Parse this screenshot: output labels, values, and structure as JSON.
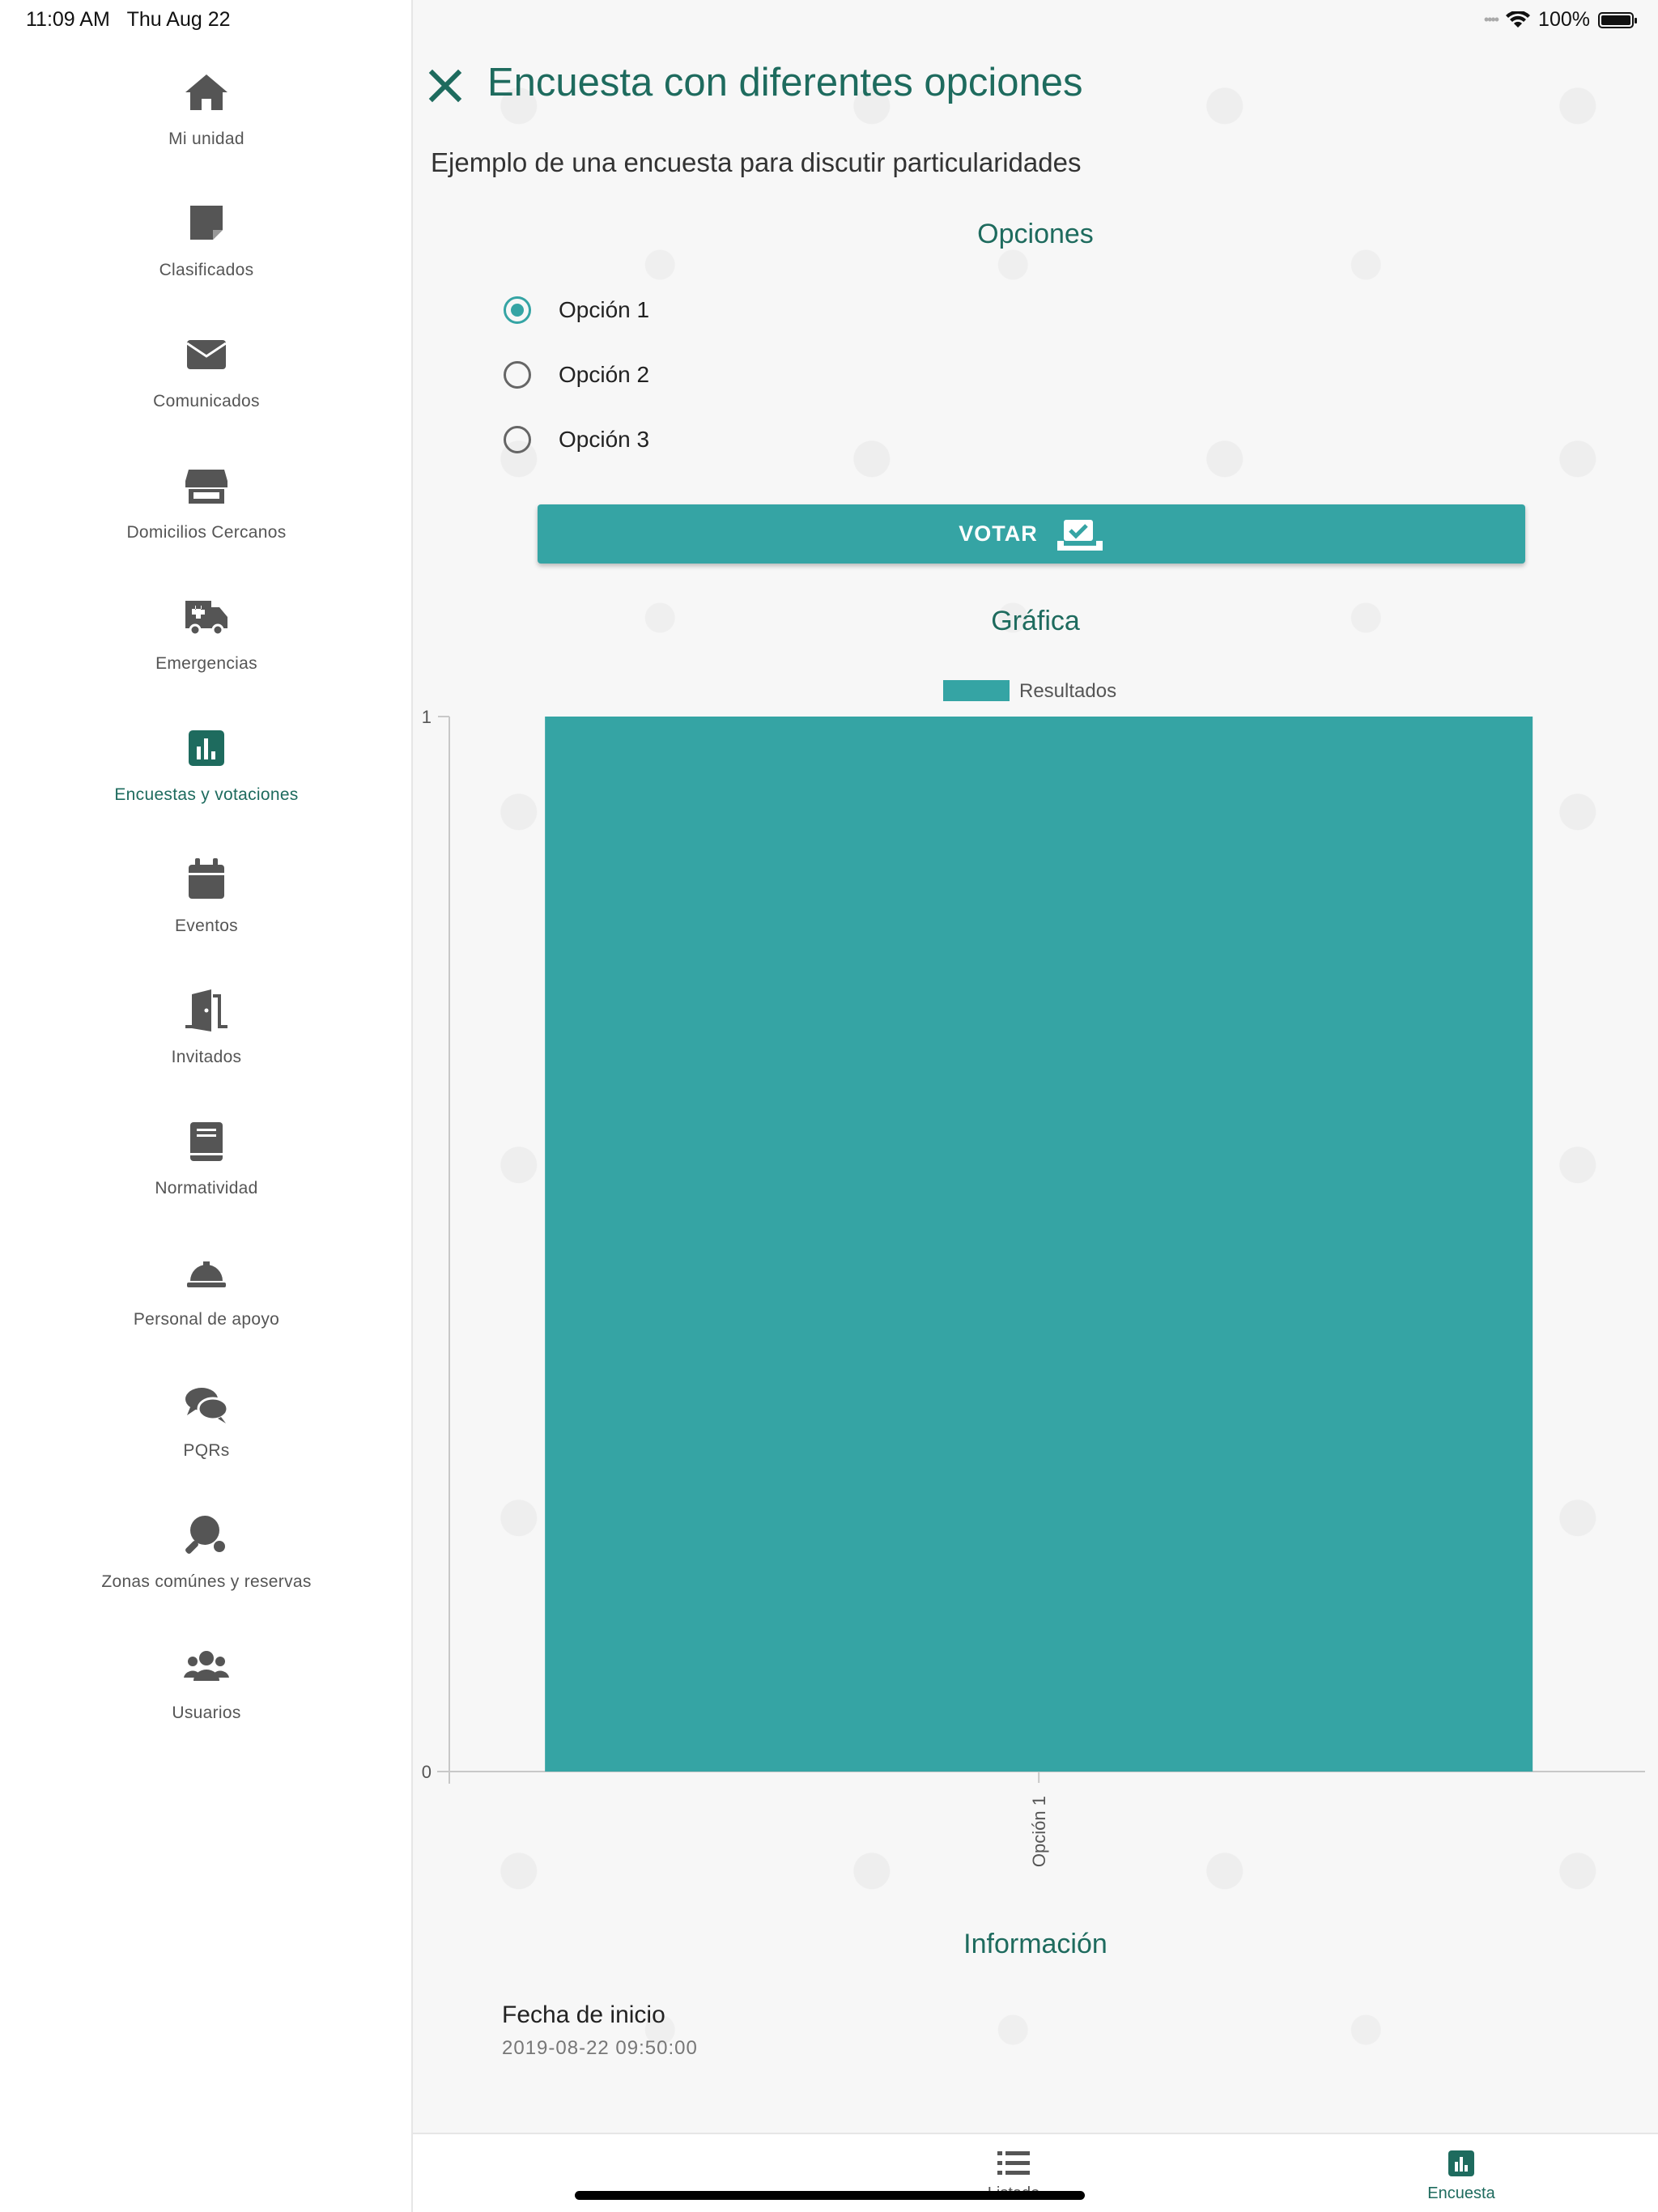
{
  "status_bar": {
    "time": "11:09 AM",
    "date": "Thu Aug 22",
    "battery": "100%"
  },
  "sidebar": {
    "items": [
      {
        "label": "Mi unidad",
        "icon": "home-icon",
        "active": false
      },
      {
        "label": "Clasificados",
        "icon": "sticky-note-icon",
        "active": false
      },
      {
        "label": "Comunicados",
        "icon": "envelope-icon",
        "active": false
      },
      {
        "label": "Domicilios Cercanos",
        "icon": "store-icon",
        "active": false
      },
      {
        "label": "Emergencias",
        "icon": "ambulance-icon",
        "active": false
      },
      {
        "label": "Encuestas y votaciones",
        "icon": "poll-chart-icon",
        "active": true
      },
      {
        "label": "Eventos",
        "icon": "calendar-icon",
        "active": false
      },
      {
        "label": "Invitados",
        "icon": "door-open-icon",
        "active": false
      },
      {
        "label": "Normatividad",
        "icon": "book-icon",
        "active": false
      },
      {
        "label": "Personal de apoyo",
        "icon": "hard-hat-icon",
        "active": false
      },
      {
        "label": "PQRs",
        "icon": "comments-icon",
        "active": false
      },
      {
        "label": "Zonas comúnes y reservas",
        "icon": "ping-pong-icon",
        "active": false
      },
      {
        "label": "Usuarios",
        "icon": "users-icon",
        "active": false
      }
    ]
  },
  "poll": {
    "title": "Encuesta con diferentes opciones",
    "description": "Ejemplo de una encuesta para discutir particularidades",
    "options_title": "Opciones",
    "options": [
      {
        "label": "Opción 1",
        "selected": true
      },
      {
        "label": "Opción 2",
        "selected": false
      },
      {
        "label": "Opción 3",
        "selected": false
      }
    ],
    "vote_label": "VOTAR",
    "chart_title": "Gráfica",
    "info_title": "Información",
    "info": {
      "start_label": "Fecha de inicio",
      "start_value": "2019-08-22 09:50:00"
    }
  },
  "chart_data": {
    "type": "bar",
    "categories": [
      "Opción 1"
    ],
    "series": [
      {
        "name": "Resultados",
        "values": [
          1
        ]
      }
    ],
    "ylim": [
      0,
      1
    ],
    "yticks": [
      0,
      1
    ],
    "bar_color": "#35a4a4",
    "legend": "top-center",
    "grid": false
  },
  "tabbar": {
    "tabs": [
      {
        "label": "Listado",
        "icon": "list-icon",
        "active": false
      },
      {
        "label": "Encuesta",
        "icon": "poll-chart-icon",
        "active": true
      }
    ]
  },
  "colors": {
    "accent": "#35a4a4",
    "primary_text": "#1e6b5e",
    "icon_gray": "#555555"
  }
}
